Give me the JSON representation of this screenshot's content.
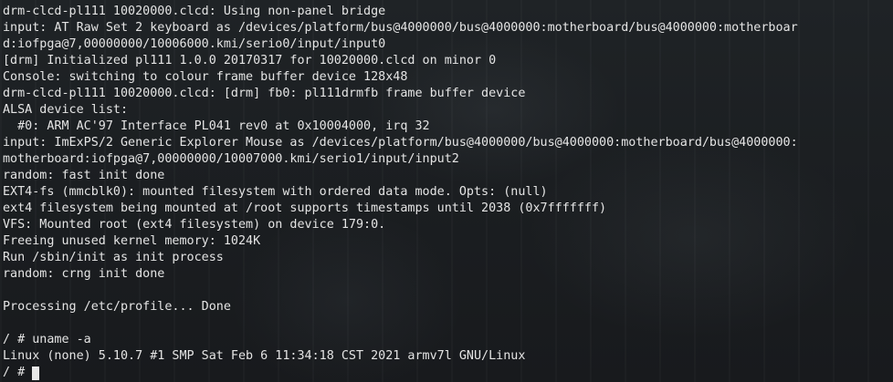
{
  "terminal": {
    "lines": [
      "drm-clcd-pl111 10020000.clcd: Using non-panel bridge",
      "input: AT Raw Set 2 keyboard as /devices/platform/bus@4000000/bus@4000000:motherboard/bus@4000000:motherboar",
      "d:iofpga@7,00000000/10006000.kmi/serio0/input/input0",
      "[drm] Initialized pl111 1.0.0 20170317 for 10020000.clcd on minor 0",
      "Console: switching to colour frame buffer device 128x48",
      "drm-clcd-pl111 10020000.clcd: [drm] fb0: pl111drmfb frame buffer device",
      "ALSA device list:",
      "  #0: ARM AC'97 Interface PL041 rev0 at 0x10004000, irq 32",
      "input: ImExPS/2 Generic Explorer Mouse as /devices/platform/bus@4000000/bus@4000000:motherboard/bus@4000000:",
      "motherboard:iofpga@7,00000000/10007000.kmi/serio1/input/input2",
      "random: fast init done",
      "EXT4-fs (mmcblk0): mounted filesystem with ordered data mode. Opts: (null)",
      "ext4 filesystem being mounted at /root supports timestamps until 2038 (0x7fffffff)",
      "VFS: Mounted root (ext4 filesystem) on device 179:0.",
      "Freeing unused kernel memory: 1024K",
      "Run /sbin/init as init process",
      "random: crng init done",
      "",
      "Processing /etc/profile... Done",
      "",
      "/ # uname -a",
      "Linux (none) 5.10.7 #1 SMP Sat Feb 6 11:34:18 CST 2021 armv7l GNU/Linux"
    ],
    "prompt": "/ # "
  },
  "colors": {
    "text": "#e4e4e4",
    "background": "#1c1f22",
    "cursor": "#e8e8e8"
  }
}
